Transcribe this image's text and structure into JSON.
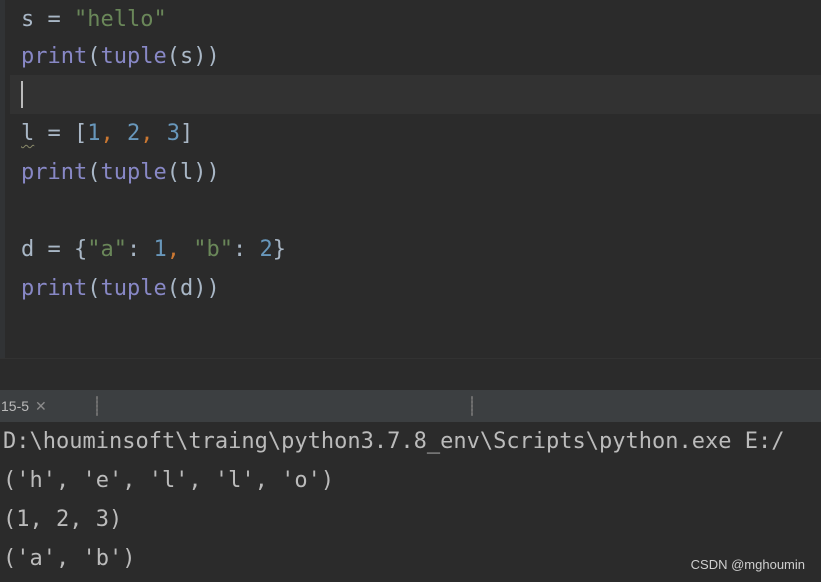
{
  "editor": {
    "line1": {
      "var": "s",
      "eq": " = ",
      "str": "\"hello\""
    },
    "line2": {
      "fn": "print",
      "open1": "(",
      "fn2": "tuple",
      "open2": "(",
      "arg": "s",
      "close": "))"
    },
    "line4": {
      "var": "l",
      "eq": " = ",
      "lb": "[",
      "n1": "1",
      "c1": ", ",
      "n2": "2",
      "c2": ", ",
      "n3": "3",
      "rb": "]"
    },
    "line5": {
      "fn": "print",
      "open1": "(",
      "fn2": "tuple",
      "open2": "(",
      "arg": "l",
      "close": "))"
    },
    "line7": {
      "var": "d",
      "eq": " = ",
      "lb": "{",
      "k1": "\"a\"",
      "colon1": ": ",
      "v1": "1",
      "c1": ", ",
      "k2": "\"b\"",
      "colon2": ": ",
      "v2": "2",
      "rb": "}"
    },
    "line8": {
      "fn": "print",
      "open1": "(",
      "fn2": "tuple",
      "open2": "(",
      "arg": "d",
      "close": "))"
    }
  },
  "run_panel": {
    "tab_label": "15-5",
    "close_glyph": "✕"
  },
  "console": {
    "lines": [
      "D:\\houminsoft\\traing\\python3.7.8_env\\Scripts\\python.exe E:/",
      "('h', 'e', 'l', 'l', 'o')",
      "(1, 2, 3)",
      "('a', 'b')"
    ]
  },
  "watermark": "CSDN @mghoumin",
  "colors": {
    "background": "#2b2b2b",
    "string": "#6a8759",
    "number": "#6897bb",
    "comma": "#cc7832",
    "builtin": "#8888c6",
    "text": "#a9b7c6"
  }
}
